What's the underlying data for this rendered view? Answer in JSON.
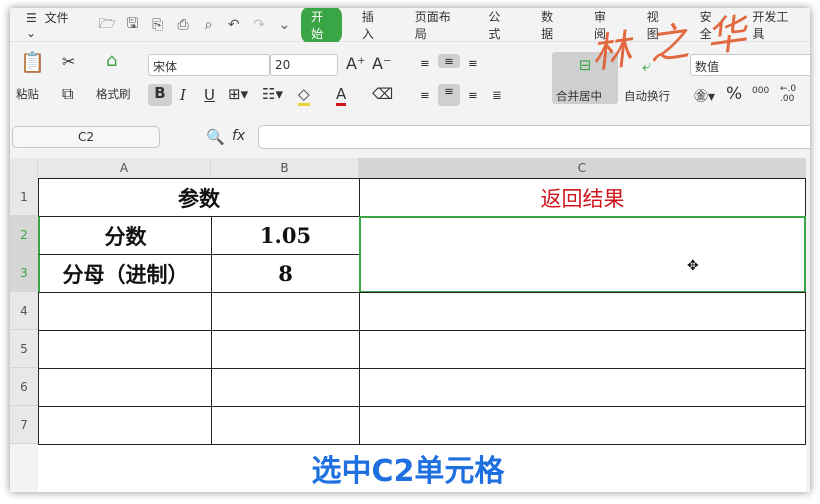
{
  "menubar": {
    "file": "文件",
    "tabs": [
      "开始",
      "插入",
      "页面布局",
      "公式",
      "数据",
      "审阅",
      "视图",
      "安全",
      "开发工具"
    ]
  },
  "ribbon": {
    "paste": "粘贴",
    "format_painter": "格式刷",
    "font_name": "宋体",
    "font_size": "20",
    "merge_center": "合并居中",
    "wrap_text": "自动换行",
    "number_format": "数值",
    "percent": "%",
    "thousands": "000",
    "decimals": "←.0 .00"
  },
  "formula_bar": {
    "name_box": "C2",
    "fx": "fx",
    "value": ""
  },
  "columns": [
    "A",
    "B",
    "C"
  ],
  "rows": [
    "1",
    "2",
    "3",
    "4",
    "5",
    "6",
    "7"
  ],
  "cells": {
    "a1": "参数",
    "c1": "返回结果",
    "a2": "分数",
    "b2": "1.05",
    "a3": "分母（进制）",
    "b3": "8"
  },
  "caption": "选中C2单元格",
  "signature": "林之华",
  "colors": {
    "accent": "#3aa544",
    "red": "#d0141c",
    "caption": "#1e6fe0"
  }
}
